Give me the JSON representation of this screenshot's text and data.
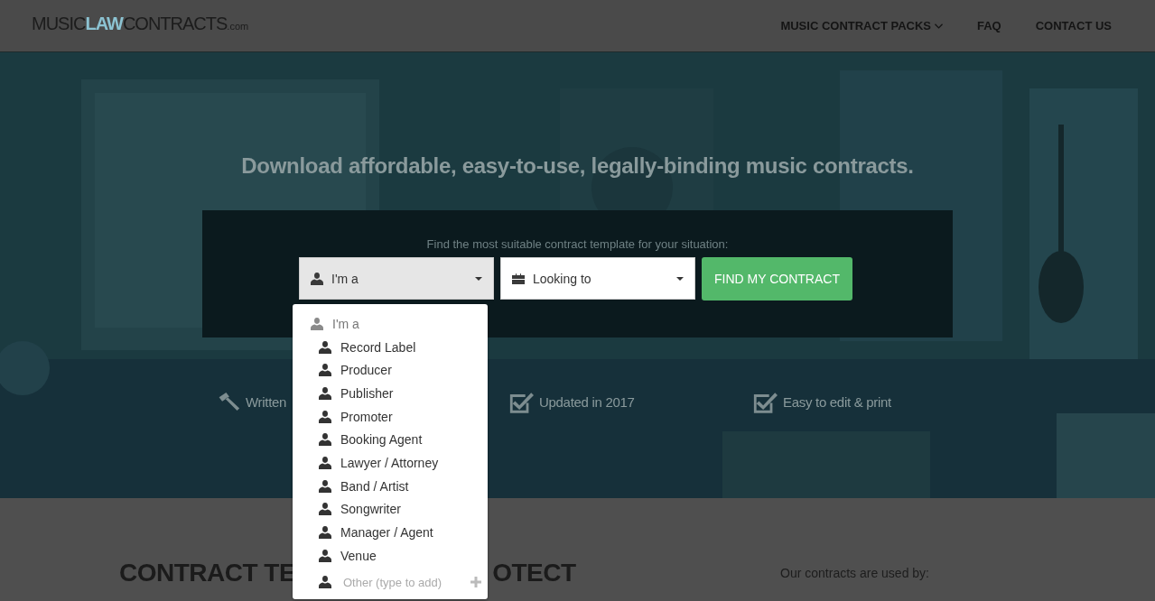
{
  "nav": {
    "logo": [
      {
        "text": "MUSIC",
        "kind": "plain"
      },
      {
        "text": "LAW",
        "kind": "accent"
      },
      {
        "text": "CONTRACTS",
        "kind": "plain"
      },
      {
        "text": ".com",
        "kind": "small"
      }
    ],
    "links": [
      {
        "label": "MUSIC CONTRACT PACKS",
        "dropdown": true
      },
      {
        "label": "FAQ",
        "dropdown": false
      },
      {
        "label": "CONTACT US",
        "dropdown": false
      }
    ]
  },
  "hero": {
    "tagline": "Download affordable, easy-to-use, legally-binding music contracts.",
    "finder": {
      "prompt": "Find the most suitable contract template for your situation:",
      "selects": [
        {
          "value": "I'm a",
          "open": true
        },
        {
          "value": "Looking to",
          "open": false
        }
      ],
      "button": "FIND MY CONTRACT"
    },
    "features": [
      {
        "text": "Written"
      },
      {
        "text": "Updated in 2017"
      },
      {
        "text": "Easy to edit & print"
      }
    ]
  },
  "dropdown": {
    "items": [
      {
        "kind": "placeholder",
        "label": "I'm a"
      },
      {
        "kind": "option",
        "label": "Record Label"
      },
      {
        "kind": "option",
        "label": "Producer"
      },
      {
        "kind": "option",
        "label": "Publisher"
      },
      {
        "kind": "option",
        "label": "Promoter"
      },
      {
        "kind": "option",
        "label": "Booking Agent"
      },
      {
        "kind": "option",
        "label": "Lawyer / Attorney"
      },
      {
        "kind": "option",
        "label": "Band / Artist"
      },
      {
        "kind": "option",
        "label": "Songwriter"
      },
      {
        "kind": "option",
        "label": "Manager / Agent"
      },
      {
        "kind": "option",
        "label": "Venue"
      },
      {
        "kind": "input",
        "placeholder": "Other (type to add)"
      }
    ]
  },
  "section": {
    "heading_parts": [
      "CONTRACT TE",
      "OTECT"
    ],
    "used_by": "Our contracts are used by:"
  }
}
